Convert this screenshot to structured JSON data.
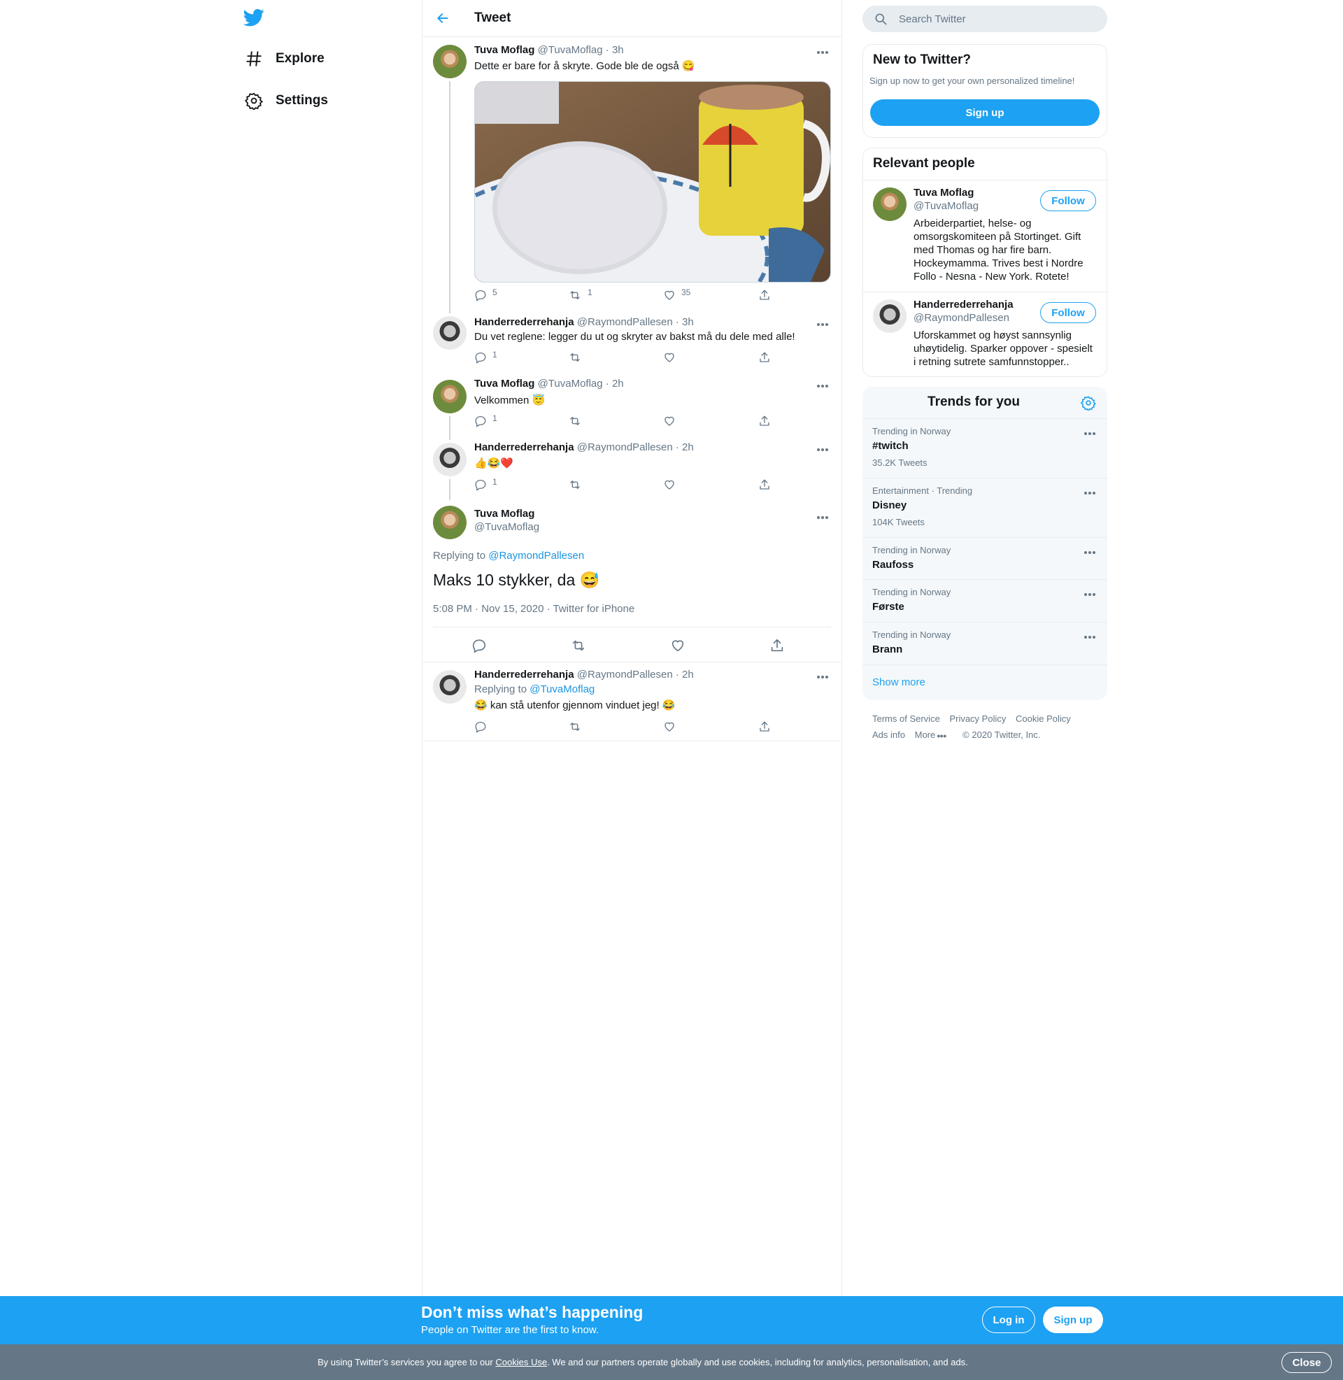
{
  "nav": {
    "explore_label": "Explore",
    "settings_label": "Settings"
  },
  "header": {
    "title": "Tweet"
  },
  "thread": [
    {
      "name": "Tuva Moflag",
      "handle": "@TuvaMoflag",
      "time": "· 3h",
      "text": "Dette er bare for å skryte. Gode ble de også 😋",
      "replies": "5",
      "retweets": "1",
      "likes": "35"
    },
    {
      "name": "Handerrederrehanja",
      "handle": "@RaymondPallesen",
      "time": "· 3h",
      "text": "Du vet reglene: legger du ut og skryter av bakst må du dele med alle!",
      "replies": "1",
      "retweets": "",
      "likes": ""
    },
    {
      "name": "Tuva Moflag",
      "handle": "@TuvaMoflag",
      "time": "· 2h",
      "text": "Velkommen 😇",
      "replies": "1",
      "retweets": "",
      "likes": ""
    },
    {
      "name": "Handerrederrehanja",
      "handle": "@RaymondPallesen",
      "time": "· 2h",
      "text": "👍😂❤️",
      "replies": "1",
      "retweets": "",
      "likes": ""
    }
  ],
  "main_tweet": {
    "name": "Tuva Moflag",
    "handle": "@TuvaMoflag",
    "replying_prefix": "Replying to",
    "replying_to": "@RaymondPallesen",
    "text": "Maks 10 stykker, da 😅",
    "meta": "5:08 PM · Nov 15, 2020 · Twitter for iPhone"
  },
  "reply": {
    "name": "Handerrederrehanja",
    "handle": "@RaymondPallesen",
    "time": "· 2h",
    "replying_prefix": "Replying to",
    "replying_to": "@TuvaMoflag",
    "text": "😂 kan stå utenfor gjennom vinduet jeg! 😂"
  },
  "search": {
    "placeholder": "Search Twitter"
  },
  "new_to_twitter": {
    "title": "New to Twitter?",
    "subtitle": "Sign up now to get your own personalized timeline!",
    "signup_label": "Sign up"
  },
  "relevant_people": {
    "title": "Relevant people",
    "people": [
      {
        "name": "Tuva Moflag",
        "handle": "@TuvaMoflag",
        "follow_label": "Follow",
        "bio": "Arbeiderpartiet, helse- og omsorgskomiteen på Stortinget. Gift med Thomas og har fire barn. Hockeymamma. Trives best i Nordre Follo - Nesna - New York. Rotete!"
      },
      {
        "name": "Handerrederrehanja",
        "handle": "@RaymondPallesen",
        "follow_label": "Follow",
        "bio": "Uforskammet og høyst sannsynlig uhøytidelig. Sparker oppover - spesielt i retning sutrete samfunnstopper.."
      }
    ]
  },
  "trends": {
    "title": "Trends for you",
    "items": [
      {
        "context": "Trending in Norway",
        "name": "#twitch",
        "count": "35.2K Tweets"
      },
      {
        "context": "Entertainment · Trending",
        "name": "Disney",
        "count": "104K Tweets"
      },
      {
        "context": "Trending in Norway",
        "name": "Raufoss",
        "count": ""
      },
      {
        "context": "Trending in Norway",
        "name": "Første",
        "count": ""
      },
      {
        "context": "Trending in Norway",
        "name": "Brann",
        "count": ""
      }
    ],
    "show_more": "Show more"
  },
  "footer": {
    "terms": "Terms of Service",
    "privacy": "Privacy Policy",
    "cookie": "Cookie Policy",
    "ads": "Ads info",
    "more": "More",
    "copyright": "© 2020 Twitter, Inc."
  },
  "signup_bar": {
    "title": "Don’t miss what’s happening",
    "subtitle": "People on Twitter are the first to know.",
    "login_label": "Log in",
    "signup_label": "Sign up"
  },
  "cookie_bar": {
    "text_before": "By using Twitter’s services you agree to our ",
    "link": "Cookies Use",
    "text_after": ". We and our partners operate globally and use cookies, including for analytics, personalisation, and ads.",
    "close_label": "Close"
  },
  "colors": {
    "accent": "#1da1f2",
    "text": "#14171a",
    "muted": "#657786",
    "border": "#e6ecf0"
  }
}
